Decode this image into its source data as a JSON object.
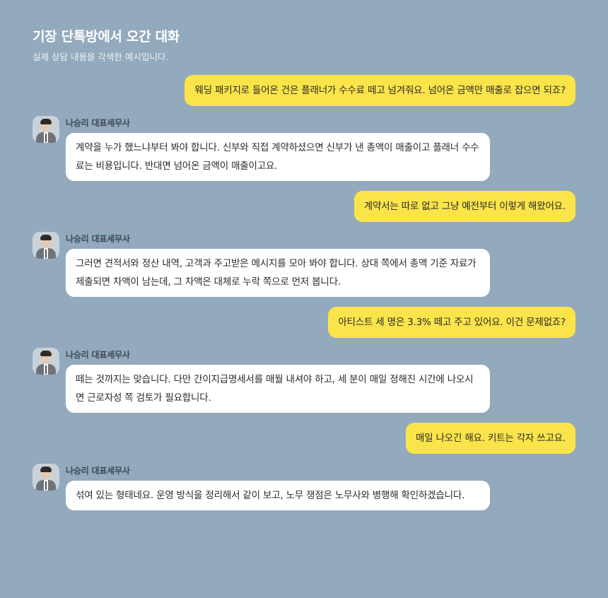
{
  "header": {
    "title": "기장 단톡방에서 오간 대화",
    "subtitle": "실제 상담 내용을 각색한 예시입니다."
  },
  "colors": {
    "background": "#93a9bd",
    "outgoing_bubble": "#fbe44a",
    "incoming_bubble": "#ffffff"
  },
  "messages": [
    {
      "direction": "out",
      "text": "웨딩 패키지로 들어온 건은 플래너가 수수료 떼고 넘겨줘요. 넘어온 금액만 매출로 잡으면 되죠?"
    },
    {
      "direction": "in",
      "sender": "나승리 대표세무사",
      "avatar_icon": "person-in-suit-avatar",
      "text": "계약을 누가 했느냐부터 봐야 합니다. 신부와 직접 계약하셨으면 신부가 낸 총액이 매출이고 플래너 수수료는 비용입니다. 반대면 넘어온 금액이 매출이고요."
    },
    {
      "direction": "out",
      "text": "계약서는 따로 없고 그냥 예전부터 이렇게 해왔어요."
    },
    {
      "direction": "in",
      "sender": "나승리 대표세무사",
      "avatar_icon": "person-in-suit-avatar",
      "text": "그러면 견적서와 정산 내역, 고객과 주고받은 메시지를 모아 봐야 합니다. 상대 쪽에서 총액 기준 자료가 제출되면 차액이 남는데, 그 차액은 대체로 누락 쪽으로 먼저 봅니다."
    },
    {
      "direction": "out",
      "text": "아티스트 세 명은 3.3% 떼고 주고 있어요. 이건 문제없죠?"
    },
    {
      "direction": "in",
      "sender": "나승리 대표세무사",
      "avatar_icon": "person-in-suit-avatar",
      "text": "떼는 것까지는 맞습니다. 다만 간이지급명세서를 매월 내셔야 하고, 세 분이 매일 정해진 시간에 나오시면 근로자성 쪽 검토가 필요합니다."
    },
    {
      "direction": "out",
      "text": "매일 나오긴 해요. 키트는 각자 쓰고요."
    },
    {
      "direction": "in",
      "sender": "나승리 대표세무사",
      "avatar_icon": "person-in-suit-avatar",
      "text": "섞여 있는 형태네요. 운영 방식을 정리해서 같이 보고, 노무 쟁점은 노무사와 병행해 확인하겠습니다."
    }
  ]
}
